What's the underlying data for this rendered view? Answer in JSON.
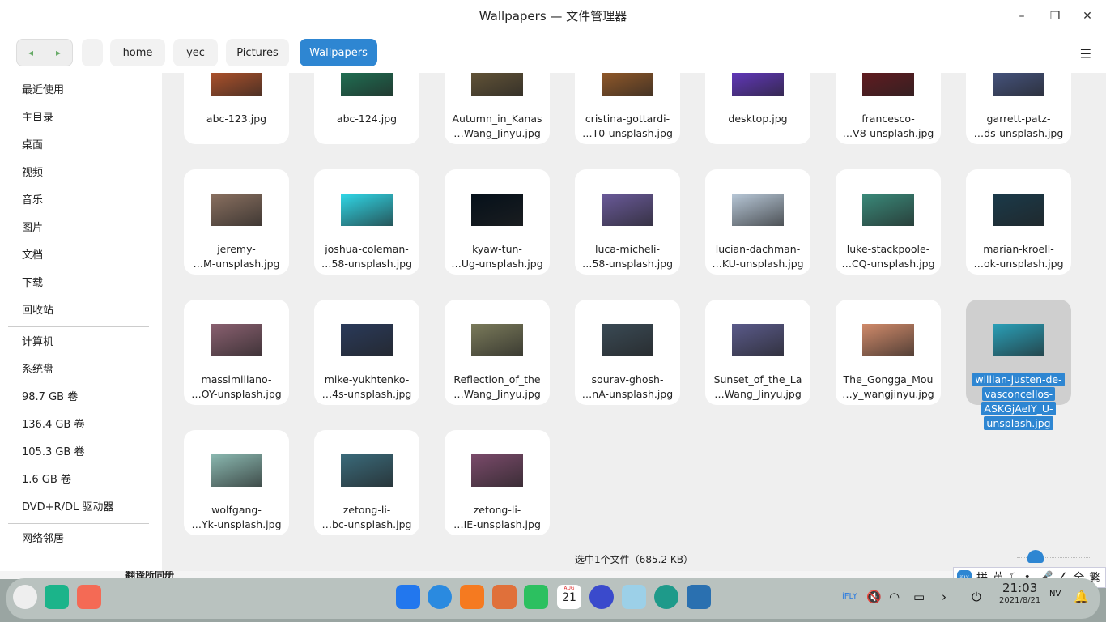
{
  "window": {
    "title": "Wallpapers — 文件管理器",
    "minimize": "–",
    "maximize": "❐",
    "close": "✕"
  },
  "toolbar": {
    "back": "◂",
    "forward": "▸",
    "crumbs": [
      "",
      "home",
      "yec",
      "Pictures",
      "Wallpapers"
    ],
    "menu": "☰"
  },
  "sidebar": {
    "group1": [
      "最近使用",
      "主目录",
      "桌面",
      "视频",
      "音乐",
      "图片",
      "文档",
      "下载",
      "回收站"
    ],
    "group2": [
      "计算机",
      "系统盘",
      "98.7 GB 卷",
      "136.4 GB 卷",
      "105.3 GB 卷",
      "1.6 GB 卷",
      "DVD+R/DL 驱动器"
    ],
    "group3": [
      "网络邻居"
    ]
  },
  "files": [
    {
      "name": [
        "abc-123.jpg"
      ],
      "color": "#c0582c"
    },
    {
      "name": [
        "abc-124.jpg"
      ],
      "color": "#1f7a5a"
    },
    {
      "name": [
        "Autumn_in_Kanas",
        "…Wang_Jinyu.jpg"
      ],
      "color": "#6b5a3a"
    },
    {
      "name": [
        "cristina-gottardi-",
        "…T0-unsplash.jpg"
      ],
      "color": "#a0602a"
    },
    {
      "name": [
        "desktop.jpg"
      ],
      "color": "#6a3ad0"
    },
    {
      "name": [
        "francesco-",
        "…V8-unsplash.jpg"
      ],
      "color": "#6a1a20"
    },
    {
      "name": [
        "garrett-patz-",
        "…ds-unsplash.jpg"
      ],
      "color": "#4a5a8a"
    },
    {
      "name": [
        "jeremy-",
        "…M-unsplash.jpg"
      ],
      "color": "#8a7060"
    },
    {
      "name": [
        "joshua-coleman-",
        "…58-unsplash.jpg"
      ],
      "color": "#30d8e8"
    },
    {
      "name": [
        "kyaw-tun-",
        "…Ug-unsplash.jpg"
      ],
      "color": "#05101a"
    },
    {
      "name": [
        "luca-micheli-",
        "…58-unsplash.jpg"
      ],
      "color": "#6a5a9a"
    },
    {
      "name": [
        "lucian-dachman-",
        "…KU-unsplash.jpg"
      ],
      "color": "#b8c8d8"
    },
    {
      "name": [
        "luke-stackpoole-",
        "…CQ-unsplash.jpg"
      ],
      "color": "#3a8a7a"
    },
    {
      "name": [
        "marian-kroell-",
        "…ok-unsplash.jpg"
      ],
      "color": "#1a3a4a"
    },
    {
      "name": [
        "massimiliano-",
        "…OY-unsplash.jpg"
      ],
      "color": "#8a6070"
    },
    {
      "name": [
        "mike-yukhtenko-",
        "…4s-unsplash.jpg"
      ],
      "color": "#2a3a5a"
    },
    {
      "name": [
        "Reflection_of_the",
        "…Wang_Jinyu.jpg"
      ],
      "color": "#7a7a5a"
    },
    {
      "name": [
        "sourav-ghosh-",
        "…nA-unsplash.jpg"
      ],
      "color": "#3a4a55"
    },
    {
      "name": [
        "Sunset_of_the_La",
        "…Wang_Jinyu.jpg"
      ],
      "color": "#5a5a8a"
    },
    {
      "name": [
        "The_Gongga_Mou",
        "…y_wangjinyu.jpg"
      ],
      "color": "#d08a6a"
    },
    {
      "name": [
        "willian-justen-de-",
        "vasconcellos-",
        "ASKGjAeIY_U-",
        "unsplash.jpg"
      ],
      "color": "#2aa0b8",
      "selected": true
    },
    {
      "name": [
        "wolfgang-",
        "…Yk-unsplash.jpg"
      ],
      "color": "#8ab8b0"
    },
    {
      "name": [
        "zetong-li-",
        "…bc-unsplash.jpg"
      ],
      "color": "#3a6a7a"
    },
    {
      "name": [
        "zetong-li-",
        "…IE-unsplash.jpg"
      ],
      "color": "#7a4a6a"
    }
  ],
  "status": "选中1个文件（685.2 KB）",
  "behind_text": "翻译所同册",
  "ime": {
    "items": [
      "拼",
      "英",
      "☾",
      "•,",
      "🎤",
      "∠",
      "全",
      "繁"
    ],
    "logo": "iFLY"
  },
  "taskbar": {
    "calendar_month": "AUG",
    "calendar_day": "21",
    "time": "21:03",
    "date": "2021/8/21"
  }
}
